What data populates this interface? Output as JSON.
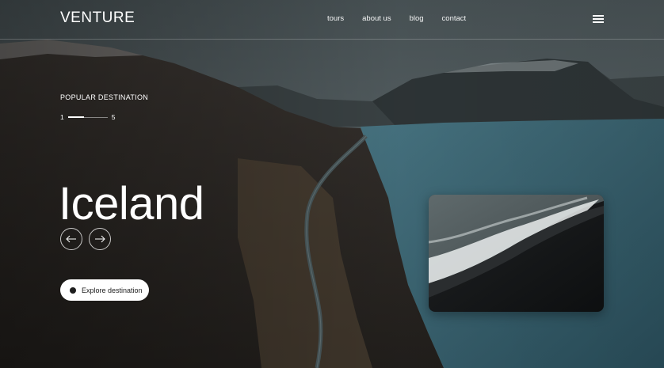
{
  "header": {
    "logo": "VENTURE",
    "nav": [
      "tours",
      "about us",
      "blog",
      "contact"
    ],
    "menu_icon": "hamburger-menu-icon"
  },
  "hero": {
    "eyebrow": "POPULAR DESTINATION",
    "pager": {
      "current": "1",
      "total": "5",
      "progress": 0.4
    },
    "title": "Iceland",
    "prev_icon": "arrow-left-icon",
    "next_icon": "arrow-right-icon",
    "cta_label": "Explore destination"
  },
  "colors": {
    "text": "#ffffff",
    "cta_bg": "#ffffff",
    "cta_text": "#1e1e1e",
    "water": "#3d6270",
    "land": "#2e2a25"
  }
}
